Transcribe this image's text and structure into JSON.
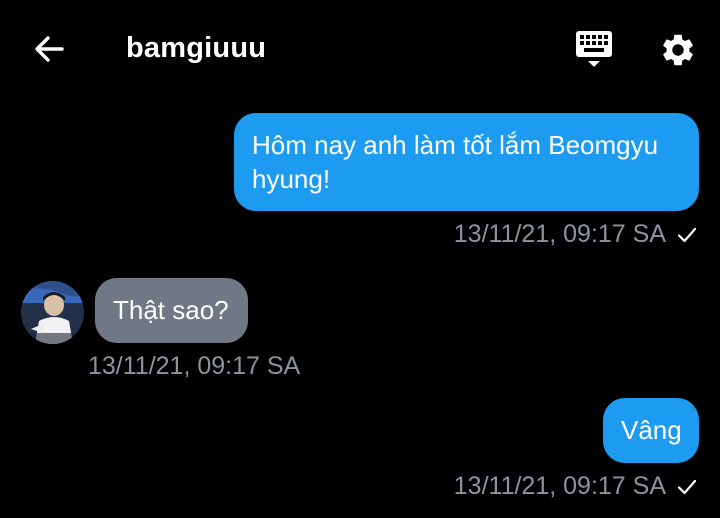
{
  "header": {
    "title": "bamgiuuu",
    "back_icon": "arrow-left-icon",
    "keyboard_icon": "keyboard-icon",
    "settings_icon": "gear-icon"
  },
  "messages": [
    {
      "direction": "outgoing",
      "text": "Hôm nay anh làm tốt lắm Beomgyu hyung!",
      "timestamp": "13/11/21, 09:17 SA",
      "status_icon": "check-icon"
    },
    {
      "direction": "incoming",
      "text": "Thật sao?",
      "timestamp": "13/11/21, 09:17 SA",
      "avatar_icon": "avatar"
    },
    {
      "direction": "outgoing",
      "text": "Vâng",
      "timestamp": "13/11/21, 09:17 SA",
      "status_icon": "check-icon"
    }
  ],
  "colors": {
    "background": "#000000",
    "outgoing_bubble": "#1d9bf0",
    "incoming_bubble": "#6f7884",
    "meta_text": "#8b949e"
  }
}
